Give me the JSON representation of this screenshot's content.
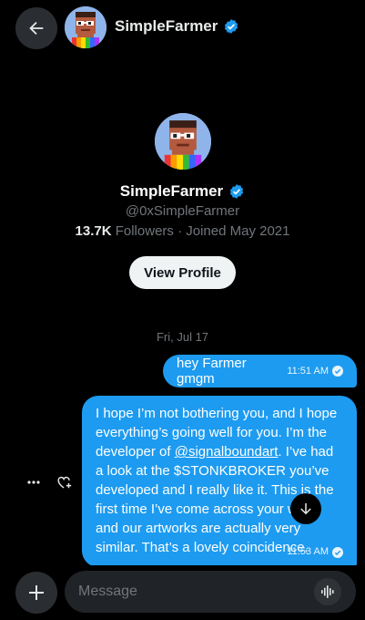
{
  "header": {
    "name": "SimpleFarmer",
    "back_icon": "arrow-left-icon",
    "verified_icon": "verified-badge-icon"
  },
  "profile": {
    "name": "SimpleFarmer",
    "handle": "@0xSimpleFarmer",
    "followers_count": "13.7K",
    "followers_label": "Followers",
    "joined": "· Joined May 2021",
    "view_button": "View Profile"
  },
  "conversation": {
    "date_separator": "Fri, Jul 17",
    "messages": [
      {
        "text": "hey Farmer gmgm",
        "time": "11:51 AM",
        "status": "read"
      },
      {
        "text_before": "I hope I’m not bothering you, and I hope everything’s going well for you. I’m the developer of ",
        "mention": "@signalboundart",
        "text_after": ". I’ve had a look at the $STONKBROKER you’ve developed and I really like it. This is the first time I’ve come across your work, and our artworks are actually very similar. That’s a lovely coincidence.",
        "time": "11:53 AM",
        "status": "read"
      }
    ]
  },
  "composer": {
    "placeholder": "Message",
    "add_icon": "plus-icon",
    "voice_icon": "voice-wave-icon"
  },
  "colors": {
    "accent": "#1d9bf0",
    "background": "#000000",
    "muted_text": "#71767b"
  }
}
